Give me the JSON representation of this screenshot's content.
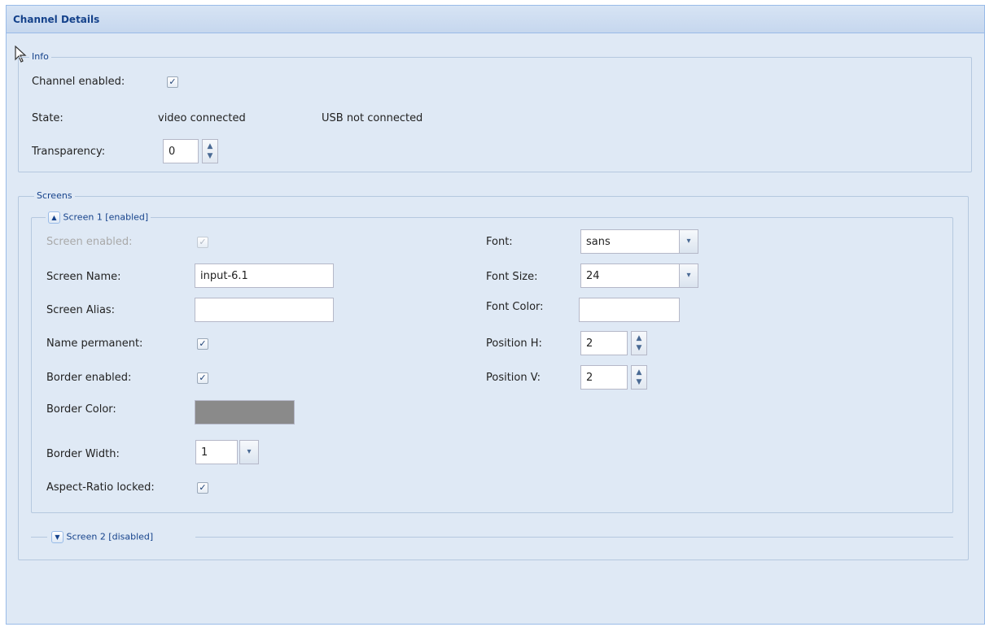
{
  "panel": {
    "title": "Channel Details"
  },
  "info": {
    "legend": "Info",
    "channel_enabled_label": "Channel enabled:",
    "channel_enabled": true,
    "state_label": "State:",
    "state_video": "video connected",
    "state_usb": "USB not connected",
    "transparency_label": "Transparency:",
    "transparency_value": "0"
  },
  "screens": {
    "legend": "Screens",
    "screen1": {
      "title": "Screen 1 [enabled]",
      "screen_enabled_label": "Screen enabled:",
      "screen_name_label": "Screen Name:",
      "screen_name_value": "input-6.1",
      "screen_alias_label": "Screen Alias:",
      "screen_alias_value": "",
      "name_permanent_label": "Name permanent:",
      "border_enabled_label": "Border enabled:",
      "border_color_label": "Border Color:",
      "border_color_value": "#8a8a8a",
      "border_width_label": "Border Width:",
      "border_width_value": "1",
      "aspect_ratio_label": "Aspect-Ratio locked:",
      "font_label": "Font:",
      "font_value": "sans",
      "font_size_label": "Font Size:",
      "font_size_value": "24",
      "font_color_label": "Font Color:",
      "font_color_value": "",
      "position_h_label": "Position H:",
      "position_h_value": "2",
      "position_v_label": "Position V:",
      "position_v_value": "2"
    },
    "screen2": {
      "title": "Screen 2 [disabled]"
    }
  },
  "icons": {
    "check": "✓",
    "spin_up": "▲",
    "spin_down": "▼",
    "combo": "▾",
    "collapse": "▲",
    "expand": "▼"
  },
  "colors": {
    "panel_bg": "#dfe9f5",
    "header_text": "#15428b",
    "border_swatch": "#8a8a8a"
  }
}
